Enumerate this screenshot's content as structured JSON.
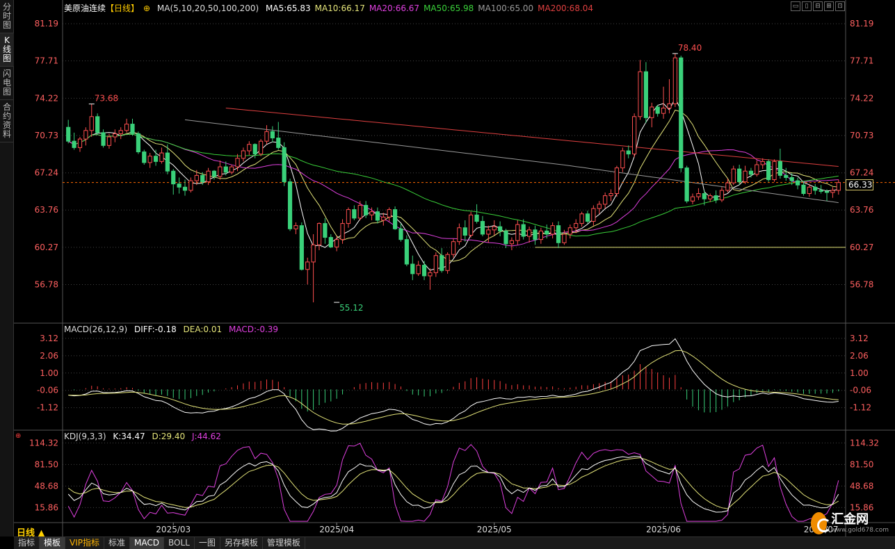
{
  "sidebar": {
    "tabs": [
      {
        "label": "分时图"
      },
      {
        "label": "K线图",
        "active": true
      },
      {
        "label": "闪电图"
      },
      {
        "label": "合约资料"
      }
    ]
  },
  "window": {
    "controls": [
      "▭",
      "▯",
      "⊟",
      "⊞",
      "⊡"
    ]
  },
  "chart": {
    "title": "美原油连续",
    "period_tag": "【日线】",
    "ma_settings": "MA(5,10,20,50,100,200)",
    "ma_values": [
      {
        "label": "MA5:65.83",
        "color": "#ffffff"
      },
      {
        "label": "MA10:66.17",
        "color": "#e5e57a"
      },
      {
        "label": "MA20:66.67",
        "color": "#e040e0"
      },
      {
        "label": "MA50:65.98",
        "color": "#3ad13a"
      },
      {
        "label": "MA100:65.00",
        "color": "#9a9a9a"
      },
      {
        "label": "MA200:68.04",
        "color": "#e04040"
      }
    ],
    "current_price": "66.33",
    "high_label": "78.40",
    "low_label": "55.12",
    "early_high_label": "73.68",
    "period_button": "日线 ▲"
  },
  "colors": {
    "up": "#ff5050",
    "down": "#3ad17a",
    "axis": "#ff6060",
    "grid": "#444444"
  },
  "chart_data": [
    {
      "type": "candlestick",
      "title": "美原油连续",
      "y_ticks": [
        "81.19",
        "77.71",
        "74.22",
        "70.73",
        "67.24",
        "63.76",
        "60.27",
        "56.78"
      ],
      "ylim": [
        53.5,
        82.5
      ],
      "x_ticks": [
        "2025/03",
        "2025/04",
        "2025/05",
        "2025/06",
        "2025/07"
      ],
      "reference_lines": [
        60.27,
        66.33
      ],
      "annotations": [
        {
          "text": "73.68",
          "x": 4,
          "y": 73.68
        },
        {
          "text": "55.12",
          "x": 46,
          "y": 55.12
        },
        {
          "text": "78.40",
          "x": 104,
          "y": 78.4
        }
      ],
      "ohlc": [
        [
          71.5,
          72.2,
          70.0,
          70.2
        ],
        [
          70.2,
          71.0,
          69.4,
          69.6
        ],
        [
          69.6,
          70.6,
          69.2,
          70.4
        ],
        [
          70.4,
          71.5,
          69.8,
          71.2
        ],
        [
          71.2,
          73.68,
          70.6,
          72.5
        ],
        [
          72.5,
          72.8,
          70.8,
          71.0
        ],
        [
          71.0,
          71.3,
          69.6,
          69.8
        ],
        [
          69.8,
          70.9,
          69.5,
          70.6
        ],
        [
          70.6,
          71.3,
          70.1,
          70.9
        ],
        [
          70.9,
          71.5,
          70.4,
          71.2
        ],
        [
          71.2,
          72.3,
          71.0,
          71.8
        ],
        [
          71.8,
          72.3,
          70.7,
          70.9
        ],
        [
          70.9,
          71.1,
          69.0,
          69.2
        ],
        [
          69.2,
          69.4,
          68.0,
          68.2
        ],
        [
          68.2,
          69.1,
          67.7,
          68.8
        ],
        [
          68.8,
          69.4,
          67.9,
          68.3
        ],
        [
          68.3,
          69.6,
          68.1,
          69.1
        ],
        [
          69.1,
          69.9,
          67.1,
          67.4
        ],
        [
          67.4,
          67.6,
          65.2,
          66.2
        ],
        [
          66.2,
          66.8,
          65.3,
          65.9
        ],
        [
          65.9,
          66.6,
          65.1,
          65.6
        ],
        [
          65.6,
          66.8,
          65.4,
          66.5
        ],
        [
          66.5,
          67.5,
          66.1,
          67.0
        ],
        [
          67.0,
          67.3,
          66.1,
          66.4
        ],
        [
          66.4,
          67.7,
          66.1,
          67.4
        ],
        [
          67.4,
          67.5,
          66.6,
          66.9
        ],
        [
          66.9,
          68.4,
          66.6,
          67.8
        ],
        [
          67.8,
          68.3,
          67.0,
          67.3
        ],
        [
          67.3,
          68.0,
          67.1,
          67.8
        ],
        [
          67.8,
          69.0,
          67.4,
          68.6
        ],
        [
          68.6,
          69.6,
          68.3,
          69.3
        ],
        [
          69.3,
          70.2,
          68.9,
          69.9
        ],
        [
          69.9,
          70.0,
          68.6,
          69.0
        ],
        [
          69.0,
          70.4,
          68.8,
          70.2
        ],
        [
          70.2,
          71.7,
          69.9,
          71.1
        ],
        [
          71.1,
          71.6,
          70.1,
          70.5
        ],
        [
          70.5,
          72.0,
          69.4,
          69.6
        ],
        [
          69.6,
          70.1,
          66.0,
          66.4
        ],
        [
          66.4,
          66.7,
          61.8,
          62.0
        ],
        [
          62.0,
          62.6,
          61.5,
          62.3
        ],
        [
          62.3,
          62.6,
          58.1,
          58.2
        ],
        [
          58.2,
          59.3,
          56.8,
          58.9
        ],
        [
          58.9,
          61.5,
          55.12,
          60.5
        ],
        [
          60.5,
          62.6,
          60.0,
          62.5
        ],
        [
          62.5,
          63.0,
          60.6,
          61.2
        ],
        [
          61.2,
          61.5,
          60.2,
          60.3
        ],
        [
          60.3,
          61.3,
          59.9,
          61.0
        ],
        [
          61.0,
          62.9,
          60.6,
          62.5
        ],
        [
          62.5,
          64.0,
          62.1,
          63.8
        ],
        [
          63.8,
          64.2,
          62.8,
          63.0
        ],
        [
          63.0,
          64.6,
          62.8,
          64.2
        ],
        [
          64.2,
          64.6,
          63.0,
          63.3
        ],
        [
          63.3,
          64.0,
          62.8,
          63.6
        ],
        [
          63.6,
          64.0,
          62.5,
          62.8
        ],
        [
          62.8,
          63.5,
          62.3,
          63.1
        ],
        [
          63.1,
          64.0,
          62.7,
          63.8
        ],
        [
          63.8,
          64.1,
          61.9,
          62.0
        ],
        [
          62.0,
          62.5,
          60.8,
          61.0
        ],
        [
          61.0,
          61.4,
          58.5,
          58.7
        ],
        [
          58.7,
          59.5,
          57.2,
          57.8
        ],
        [
          57.8,
          59.0,
          57.6,
          58.6
        ],
        [
          58.6,
          59.0,
          57.2,
          57.6
        ],
        [
          57.6,
          58.3,
          56.3,
          57.9
        ],
        [
          57.9,
          59.8,
          57.5,
          59.5
        ],
        [
          59.5,
          60.2,
          57.9,
          58.1
        ],
        [
          58.1,
          59.8,
          57.8,
          59.6
        ],
        [
          59.6,
          61.1,
          59.3,
          60.8
        ],
        [
          60.8,
          62.5,
          60.5,
          62.1
        ],
        [
          62.1,
          62.8,
          60.8,
          61.4
        ],
        [
          61.4,
          63.6,
          61.2,
          63.3
        ],
        [
          63.3,
          64.3,
          62.5,
          62.7
        ],
        [
          62.7,
          63.2,
          61.3,
          61.5
        ],
        [
          61.5,
          62.3,
          60.7,
          61.9
        ],
        [
          61.9,
          62.8,
          61.4,
          62.2
        ],
        [
          62.2,
          62.7,
          61.3,
          61.8
        ],
        [
          61.8,
          62.0,
          60.2,
          60.6
        ],
        [
          60.6,
          61.2,
          60.0,
          60.9
        ],
        [
          60.9,
          62.8,
          60.5,
          62.4
        ],
        [
          62.4,
          62.9,
          61.0,
          61.3
        ],
        [
          61.3,
          62.2,
          60.7,
          61.9
        ],
        [
          61.9,
          62.3,
          60.5,
          61.0
        ],
        [
          61.0,
          62.1,
          60.6,
          61.8
        ],
        [
          61.8,
          62.4,
          61.1,
          61.5
        ],
        [
          61.5,
          62.6,
          61.1,
          62.3
        ],
        [
          62.3,
          62.7,
          60.2,
          60.7
        ],
        [
          60.7,
          61.9,
          60.5,
          61.5
        ],
        [
          61.5,
          62.4,
          61.1,
          62.1
        ],
        [
          62.1,
          62.9,
          61.6,
          62.5
        ],
        [
          62.5,
          63.6,
          62.2,
          63.4
        ],
        [
          63.4,
          63.7,
          62.5,
          62.7
        ],
        [
          62.7,
          64.2,
          62.3,
          63.9
        ],
        [
          63.9,
          64.6,
          63.4,
          64.3
        ],
        [
          64.3,
          65.4,
          63.9,
          65.1
        ],
        [
          65.1,
          65.7,
          64.6,
          65.3
        ],
        [
          65.3,
          67.9,
          65.0,
          67.7
        ],
        [
          67.7,
          69.6,
          67.3,
          69.3
        ],
        [
          69.3,
          69.8,
          68.6,
          69.0
        ],
        [
          69.0,
          72.8,
          68.7,
          72.5
        ],
        [
          72.5,
          77.8,
          72.2,
          76.7
        ],
        [
          76.7,
          77.6,
          71.9,
          72.4
        ],
        [
          72.4,
          73.8,
          71.5,
          73.4
        ],
        [
          73.4,
          73.6,
          72.5,
          72.8
        ],
        [
          72.8,
          75.3,
          72.3,
          73.3
        ],
        [
          73.3,
          76.0,
          72.8,
          73.7
        ],
        [
          73.7,
          78.4,
          73.4,
          78.0
        ],
        [
          78.0,
          78.2,
          67.3,
          67.7
        ],
        [
          67.7,
          67.9,
          64.4,
          64.6
        ],
        [
          64.6,
          65.3,
          64.3,
          65.0
        ],
        [
          65.0,
          65.8,
          64.7,
          65.3
        ],
        [
          65.3,
          65.6,
          64.2,
          64.8
        ],
        [
          64.8,
          65.3,
          64.5,
          65.1
        ],
        [
          65.1,
          65.6,
          64.4,
          64.7
        ],
        [
          64.7,
          65.9,
          64.5,
          65.6
        ],
        [
          65.6,
          66.7,
          65.4,
          66.3
        ],
        [
          66.3,
          67.9,
          66.1,
          67.6
        ],
        [
          67.6,
          68.0,
          66.1,
          66.4
        ],
        [
          66.4,
          67.9,
          66.2,
          67.4
        ],
        [
          67.4,
          67.7,
          66.8,
          67.1
        ],
        [
          67.1,
          68.4,
          66.9,
          68.0
        ],
        [
          68.0,
          68.6,
          67.6,
          68.3
        ],
        [
          68.3,
          68.5,
          66.4,
          66.6
        ],
        [
          66.6,
          68.5,
          66.4,
          68.3
        ],
        [
          68.3,
          69.5,
          66.7,
          67.0
        ],
        [
          67.0,
          67.7,
          66.5,
          66.8
        ],
        [
          66.8,
          67.2,
          66.1,
          66.5
        ],
        [
          66.5,
          66.8,
          65.7,
          66.1
        ],
        [
          66.1,
          66.4,
          65.1,
          65.3
        ],
        [
          65.3,
          66.2,
          65.0,
          65.9
        ],
        [
          65.9,
          66.2,
          65.2,
          65.6
        ],
        [
          65.6,
          66.1,
          65.3,
          65.5
        ],
        [
          65.5,
          65.7,
          64.6,
          65.4
        ],
        [
          65.4,
          65.9,
          64.9,
          65.6
        ],
        [
          65.6,
          66.6,
          65.2,
          66.33
        ]
      ]
    },
    {
      "type": "line",
      "title": "MACD(26,12,9)",
      "legend": [
        "DIFF:-0.18",
        "DEA:0.01",
        "MACD:-0.39"
      ],
      "y_ticks": [
        "3.12",
        "2.06",
        "1.00",
        "-0.06",
        "-1.12"
      ],
      "ylim": [
        -2.2,
        3.5
      ],
      "x_ticks": [
        "2025/03",
        "2025/04",
        "2025/05",
        "2025/06",
        "2025/07"
      ]
    },
    {
      "type": "line",
      "title": "KDJ(9,3,3)",
      "legend": [
        "K:34.47",
        "D:29.40",
        "J:44.62"
      ],
      "y_ticks": [
        "114.32",
        "81.50",
        "48.68",
        "15.86"
      ],
      "ylim": [
        -7,
        120
      ],
      "x_ticks": [
        "2025/03",
        "2025/04",
        "2025/05",
        "2025/06",
        "2025/07"
      ]
    }
  ],
  "legends": {
    "macd": {
      "title": "MACD(26,12,9)",
      "diff": "DIFF:-0.18",
      "dea": "DEA:0.01",
      "macd": "MACD:-0.39"
    },
    "kdj": {
      "title": "KDJ(9,3,3)",
      "k": "K:34.47",
      "d": "D:29.40",
      "j": "J:44.62"
    }
  },
  "bottom_tabs": [
    {
      "label": "指标"
    },
    {
      "label": "模板",
      "active": true
    },
    {
      "label": "VIP指标",
      "vip": true
    },
    {
      "label": "标准"
    },
    {
      "label": "MACD",
      "active": true
    },
    {
      "label": "BOLL"
    },
    {
      "label": "一图"
    },
    {
      "label": "另存模板"
    },
    {
      "label": "管理模板"
    }
  ],
  "logo": {
    "name": "汇金网",
    "url": "www.gold678.com"
  }
}
